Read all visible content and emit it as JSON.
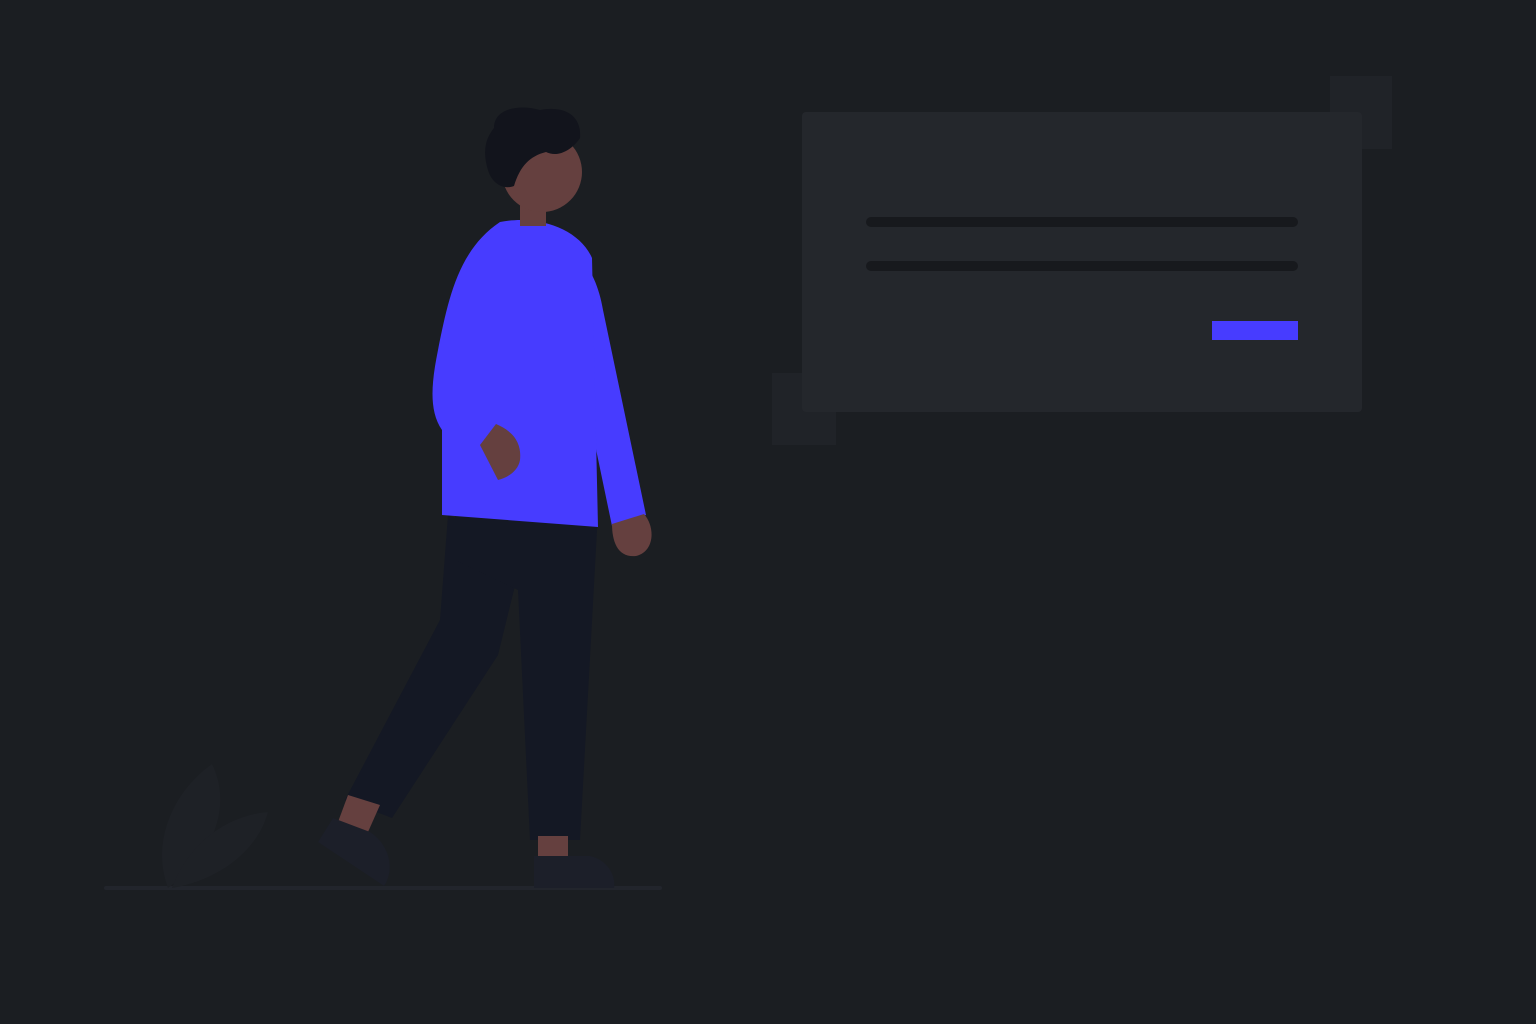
{
  "colors": {
    "background": "#1b1e22",
    "card": "#24272c",
    "card_accent_square": "#202328",
    "text_placeholder_line": "#17191d",
    "accent": "#473cff",
    "skin": "#65403f",
    "hair": "#12141c",
    "pants": "#141824",
    "shoes": "#1c1f29",
    "plant": "#1e2126",
    "ground": "#22252c"
  },
  "illustration": {
    "subject": "person-walking",
    "card_lines": 2,
    "card_action": "accent-button"
  }
}
